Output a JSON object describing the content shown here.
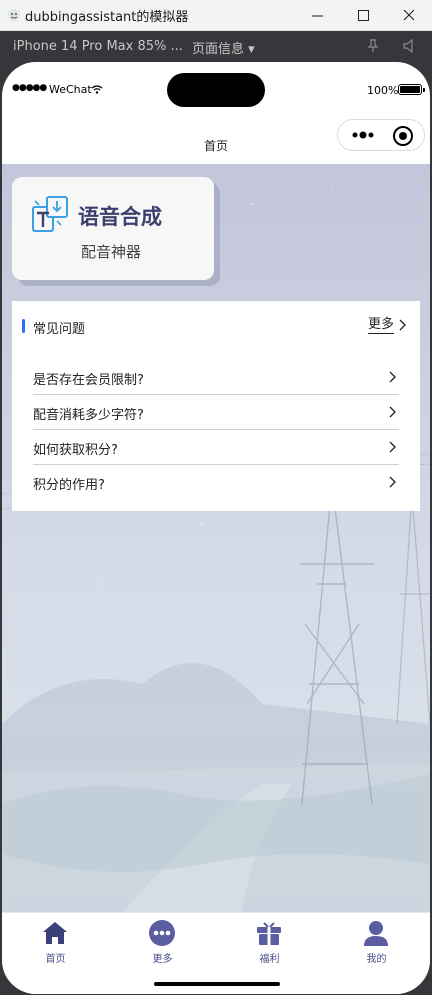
{
  "window": {
    "title": "dubbingassistant的模拟器"
  },
  "simulator": {
    "device": "iPhone 14 Pro Max 85% ...",
    "page_info": "页面信息 ▾"
  },
  "status_bar": {
    "signal": "●●●●●",
    "carrier": "WeChat",
    "battery": "100%"
  },
  "nav": {
    "title": "首页"
  },
  "hero": {
    "title": "语音合成",
    "subtitle": "配音神器"
  },
  "faq": {
    "heading": "常见问题",
    "more_label": "更多",
    "items": [
      {
        "question": "是否存在会员限制?"
      },
      {
        "question": "配音消耗多少字符?"
      },
      {
        "question": "如何获取积分?"
      },
      {
        "question": "积分的作用?"
      }
    ]
  },
  "tabbar": {
    "tabs": [
      {
        "label": "首页",
        "icon": "home-icon"
      },
      {
        "label": "更多",
        "icon": "more-dots-icon"
      },
      {
        "label": "福利",
        "icon": "gift-icon"
      },
      {
        "label": "我的",
        "icon": "user-icon"
      }
    ]
  },
  "colors": {
    "accent": "#2f6bff",
    "brand": "#3b3f6e",
    "tab_icon": "#4a4d8a",
    "simulator_bar": "#35373a"
  }
}
